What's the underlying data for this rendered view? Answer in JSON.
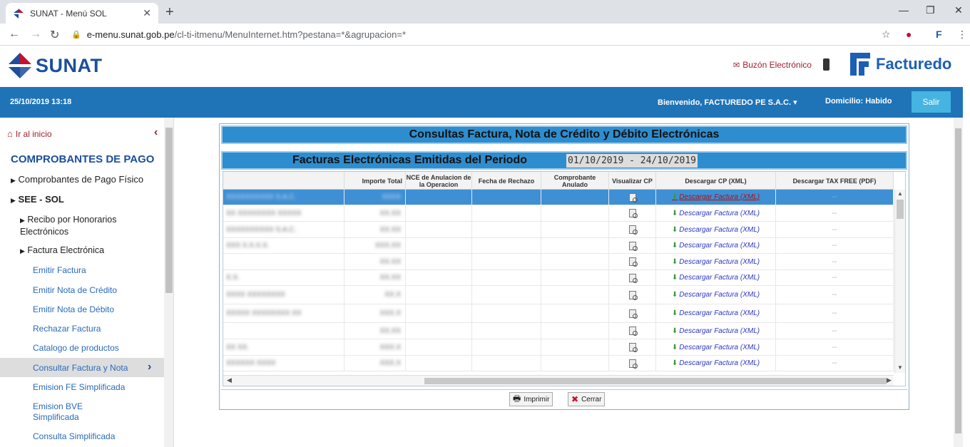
{
  "browser": {
    "tab_title": "SUNAT - Menú SOL",
    "url_main": "e-menu.sunat.gob.pe",
    "url_rest": "/cl-ti-itmenu/MenuInternet.htm?pestana=*&agrupacion=*"
  },
  "header": {
    "logo_text": "SUNAT",
    "buzon": "Buzón Electrónico",
    "brand": "Facturedo"
  },
  "bluebar": {
    "datetime": "25/10/2019 13:18",
    "welcome": "Bienvenido, FACTUREDO PE S.A.C.",
    "domicilio": "Domicilio: Habido",
    "salir": "Salir"
  },
  "sidebar": {
    "home": "Ir al inicio",
    "heading": "COMPROBANTES DE PAGO",
    "items": [
      "Comprobantes de Pago Físico",
      "SEE - SOL",
      "Recibo por Honorarios Electrónicos",
      "Factura Electrónica",
      "Emitir Factura",
      "Emitir Nota de Crédito",
      "Emitir Nota de Débito",
      "Rechazar Factura",
      "Catalogo de productos",
      "Consultar Factura y Nota",
      "Emision FE Simplificada",
      "Emision BVE Simplificada",
      "Consulta Simplificada"
    ]
  },
  "panel": {
    "title": "Consultas Factura, Nota de Crédito y Débito Electrónicas",
    "subtitle": "Facturas Electrónicas Emitidas del Periodo",
    "period": "01/10/2019 - 24/10/2019"
  },
  "grid": {
    "columns": [
      "",
      "Importe Total",
      "NCE de Anulacion de la Operacion",
      "Fecha de Rechazo",
      "Comprobante Anulado",
      "Visualizar CP",
      "Descargar CP (XML)",
      "Descargar TAX FREE (PDF)"
    ],
    "rows": [
      {
        "name": "XXXXXXXXXX S.A.C.",
        "importe": "XXXX",
        "download": "Descargar Factura (XML)",
        "tax": "--"
      },
      {
        "name": "XX XXXXXXXX XXXXX",
        "importe": "XX.XX",
        "download": "Descargar Factura (XML)",
        "tax": "--"
      },
      {
        "name": "XXXXXXXXXX S.A.C.",
        "importe": "XX.XX",
        "download": "Descargar Factura (XML)",
        "tax": "--"
      },
      {
        "name": "XXX X.X.X.X.",
        "importe": "XXX.XX",
        "download": "Descargar Factura (XML)",
        "tax": "--"
      },
      {
        "name": "",
        "importe": "XX.XX",
        "download": "Descargar Factura (XML)",
        "tax": "--"
      },
      {
        "name": "X.X.",
        "importe": "XX.XX",
        "download": "Descargar Factura (XML)",
        "tax": "--"
      },
      {
        "name": "XXXX XXXXXXXX",
        "importe": "XX.X",
        "download": "Descargar Factura (XML)",
        "tax": "--"
      },
      {
        "name": "XXXXX XXXXXXXX XX",
        "importe": "XXX.X",
        "download": "Descargar Factura (XML)",
        "tax": "--"
      },
      {
        "name": "",
        "importe": "XX.XX",
        "download": "Descargar Factura (XML)",
        "tax": "--"
      },
      {
        "name": "XX XX.",
        "importe": "XXX.X",
        "download": "Descargar Factura (XML)",
        "tax": "--"
      },
      {
        "name": "XXXXXX XXXX",
        "importe": "XXX.X",
        "download": "Descargar Factura (XML)",
        "tax": "--"
      }
    ]
  },
  "footer": {
    "print": "Imprimir",
    "close": "Cerrar"
  }
}
